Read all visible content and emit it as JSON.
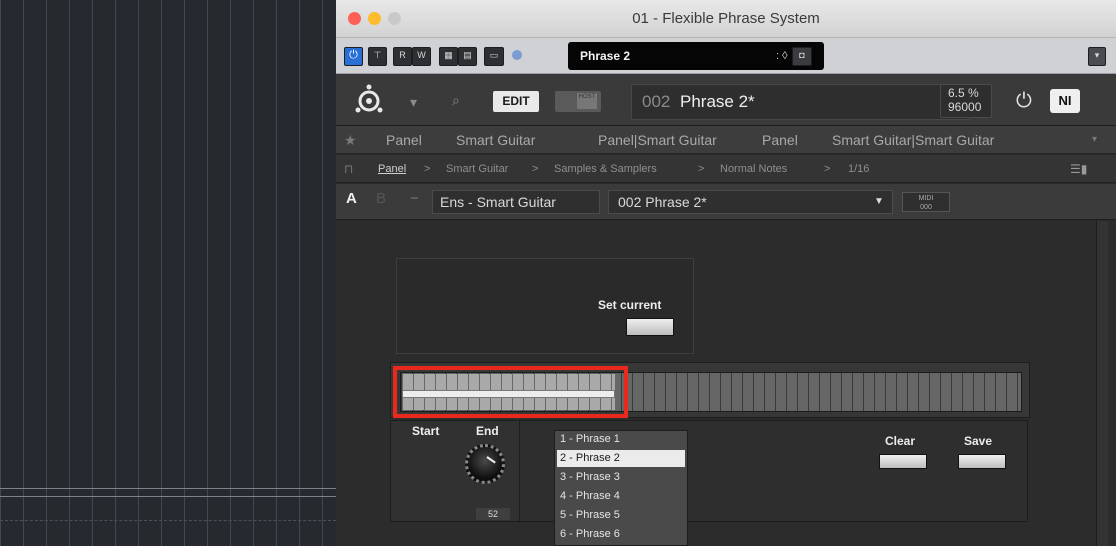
{
  "window": {
    "title": "01 - Flexible Phrase System",
    "lights": [
      "#fe5f57",
      "#febc2e",
      "#c9c9c9"
    ]
  },
  "host_toolbar": {
    "power_icon": "power-icon",
    "btn_r": "R",
    "btn_w": "W",
    "preset_name": "Phrase 2",
    "preset_arrows": ": ◊",
    "camera_icon": "camera-icon"
  },
  "kontakt_header": {
    "edit_label": "EDIT",
    "host_label": "HOST",
    "preset_number": "002",
    "preset_name": "Phrase 2*",
    "cpu_percent": "6.5 %",
    "sample_rate": "96000",
    "ni_logo": "NI"
  },
  "favorites": [
    "Panel",
    "Smart Guitar",
    "Panel|Smart Guitar",
    "Panel",
    "Smart Guitar|Smart Guitar"
  ],
  "breadcrumb": [
    "Panel",
    ">",
    "Smart Guitar",
    ">",
    "Samples & Samplers",
    ">",
    "Normal Notes",
    ">",
    "1/16"
  ],
  "instrument_bar": {
    "tab_a": "A",
    "tab_b": "B",
    "ensemble": "Ens - Smart Guitar",
    "snapshot": "002  Phrase 2*",
    "midi_top": "MIDI",
    "midi_bottom": "000"
  },
  "panel": {
    "set_current_label": "Set current",
    "start_label": "Start",
    "end_label": "End",
    "end_value": "52",
    "clear_label": "Clear",
    "save_label": "Save",
    "steps_filled": 19,
    "steps_total": 55,
    "phrases": [
      "1 - Phrase 1",
      "2 - Phrase 2",
      "3 - Phrase 3",
      "4 - Phrase 4",
      "5 - Phrase 5",
      "6 - Phrase 6"
    ],
    "selected_phrase": "2 - Phrase 2",
    "highlight_color": "#e8291b"
  }
}
